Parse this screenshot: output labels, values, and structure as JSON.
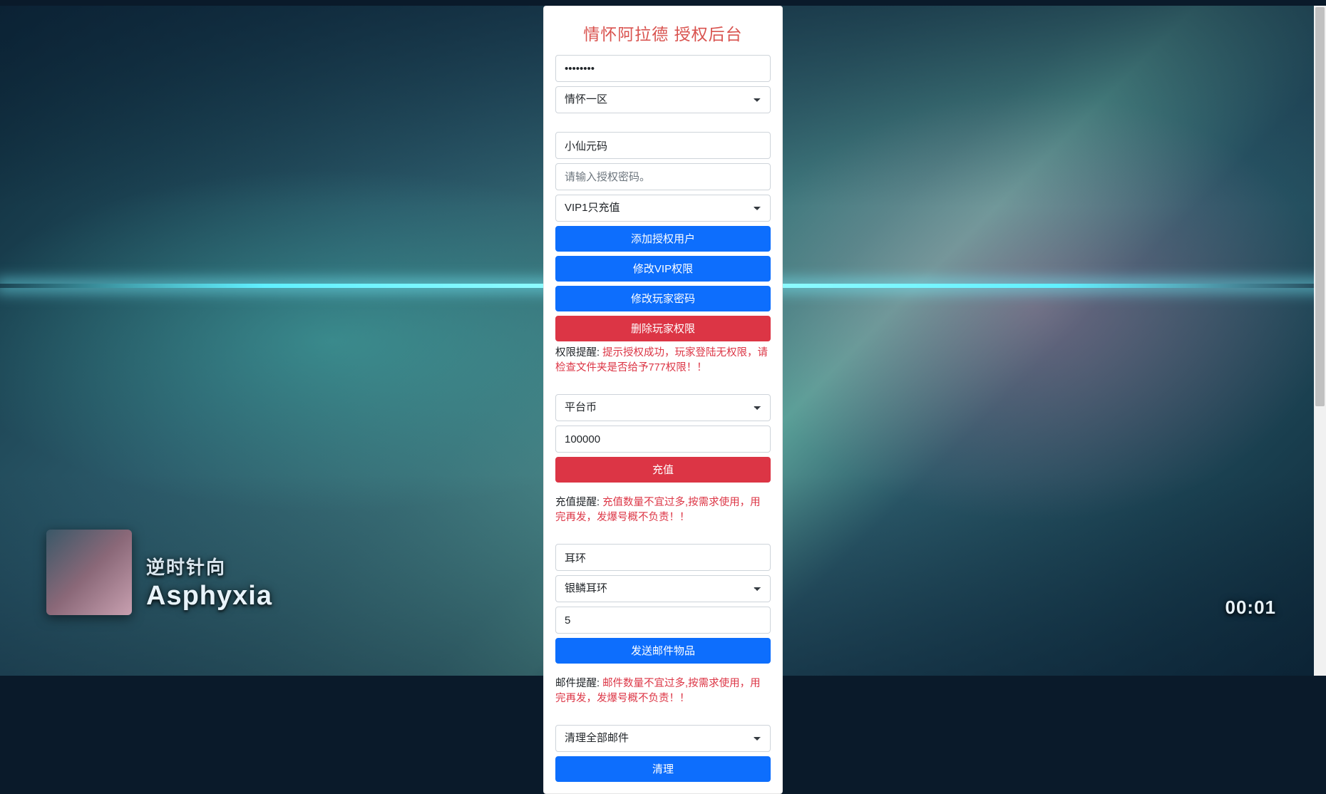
{
  "page_title": "情怀阿拉德 授权后台",
  "login": {
    "password_value": "••••••••",
    "zone_selected": "情怀一区"
  },
  "auth": {
    "code_value": "小仙元码",
    "password_placeholder": "请输入授权密码。",
    "vip_selected": "VIP1只充值",
    "add_user_label": "添加授权用户",
    "modify_vip_label": "修改VIP权限",
    "modify_pwd_label": "修改玩家密码",
    "delete_perm_label": "删除玩家权限",
    "hint_label": "权限提醒: ",
    "hint_body": "提示授权成功，玩家登陆无权限，请检查文件夹是否给予777权限！！"
  },
  "recharge": {
    "currency_selected": "平台币",
    "amount_value": "100000",
    "button_label": "充值",
    "hint_label": "充值提醒: ",
    "hint_body": "充值数量不宜过多,按需求使用，用完再发，发爆号概不负责！！"
  },
  "mail": {
    "category_value": "耳环",
    "item_selected": "银鳞耳环",
    "qty_value": "5",
    "send_label": "发送邮件物品",
    "hint_label": "邮件提醒: ",
    "hint_body": "邮件数量不宜过多,按需求使用，用完再发，发爆号概不负责！！"
  },
  "cleanup": {
    "option_selected": "清理全部邮件",
    "button_label": "清理"
  },
  "overlay": {
    "line1": "逆时针向",
    "line2": "Asphyxia",
    "timer": "00:01"
  }
}
